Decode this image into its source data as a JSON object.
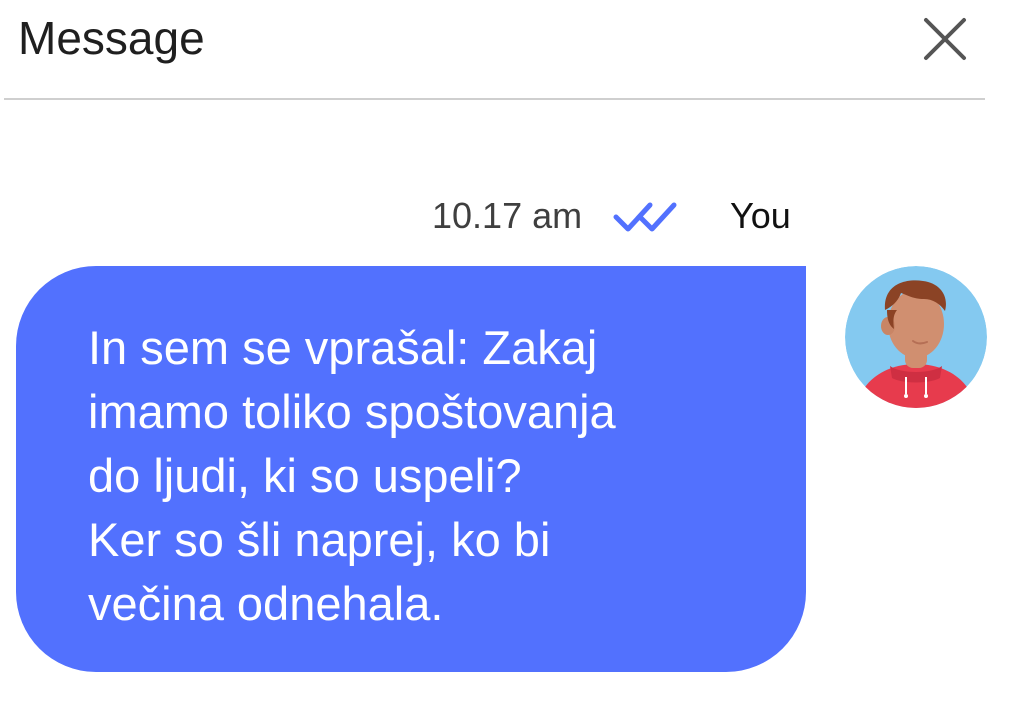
{
  "header": {
    "title": "Message",
    "close_icon": "close-icon"
  },
  "message": {
    "time": "10.17 am",
    "status_icon": "double-check-icon",
    "sender": "You",
    "text": "In sem se vprašal: Zakaj\nimamo toliko spoštovanja\ndo ljudi, ki so uspeli?\nKer so šli naprej, ko bi\nvečina odnehala.",
    "avatar_icon": "user-avatar"
  },
  "colors": {
    "bubble": "#5271fe",
    "check": "#5271fe",
    "divider": "#cfcfcf",
    "text_on_bubble": "#ffffff",
    "avatar_background": "#84c9f0",
    "hoodie": "#e73b4d"
  }
}
